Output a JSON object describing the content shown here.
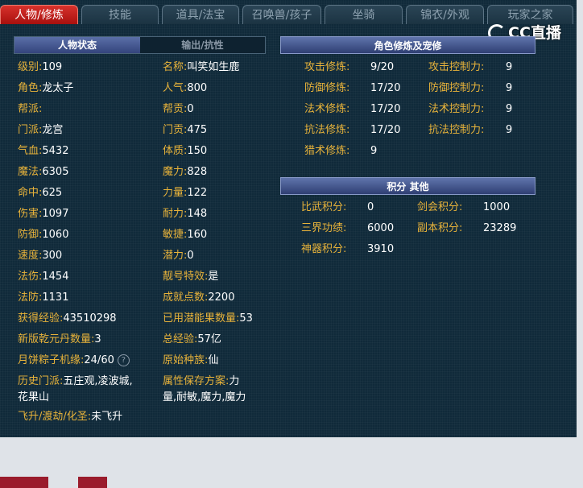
{
  "tabs": [
    "人物/修炼",
    "技能",
    "道具/法宝",
    "召唤兽/孩子",
    "坐骑",
    "锦衣/外观",
    "玩家之家"
  ],
  "logo": "CC直播",
  "subtabs": {
    "active": "人物状态",
    "inactive": "输出/抗性"
  },
  "left_stats": [
    {
      "k": "级别:",
      "v": "109"
    },
    {
      "k": "角色:",
      "v": "龙太子"
    },
    {
      "k": "帮派:",
      "v": ""
    },
    {
      "k": "门派:",
      "v": "龙宫"
    },
    {
      "k": "气血:",
      "v": "5432"
    },
    {
      "k": "魔法:",
      "v": "6305"
    },
    {
      "k": "命中:",
      "v": "625"
    },
    {
      "k": "伤害:",
      "v": "1097"
    },
    {
      "k": "防御:",
      "v": "1060"
    },
    {
      "k": "速度:",
      "v": "300"
    },
    {
      "k": "法伤:",
      "v": "1454"
    },
    {
      "k": "法防:",
      "v": "1131"
    },
    {
      "k": "获得经验:",
      "v": "43510298"
    },
    {
      "k": "新版乾元丹数量:",
      "v": "3"
    },
    {
      "k": "月饼粽子机缘:",
      "v": "24/60"
    }
  ],
  "mid_stats": [
    {
      "k": "名称:",
      "v": "叫笑如生鹿"
    },
    {
      "k": "人气:",
      "v": "800"
    },
    {
      "k": "帮贡:",
      "v": "0"
    },
    {
      "k": "门贡:",
      "v": "475"
    },
    {
      "k": "体质:",
      "v": "150"
    },
    {
      "k": "魔力:",
      "v": "828"
    },
    {
      "k": "力量:",
      "v": "122"
    },
    {
      "k": "耐力:",
      "v": "148"
    },
    {
      "k": "敏捷:",
      "v": "160"
    },
    {
      "k": "潜力:",
      "v": "0"
    },
    {
      "k": "靓号特效:",
      "v": "是"
    },
    {
      "k": "成就点数:",
      "v": "2200"
    },
    {
      "k": "已用潜能果数量:",
      "v": "53"
    },
    {
      "k": "总经验:",
      "v": "57亿"
    },
    {
      "k": "原始种族:",
      "v": "仙"
    }
  ],
  "history": {
    "k": "历史门派:",
    "v1": "五庄观,凌波城,",
    "v2": "花果山"
  },
  "attr_save": {
    "k": "属性保存方案:",
    "v1": "力",
    "v2": "量,耐敏,魔力,魔力"
  },
  "fly": {
    "k": "飞升/渡劫/化圣:",
    "v": "未飞升"
  },
  "cultivation": {
    "title": "角色修炼及宠修",
    "rows": [
      {
        "k1": "攻击修炼:",
        "v1": "9/20",
        "k2": "攻击控制力:",
        "v2": "9"
      },
      {
        "k1": "防御修炼:",
        "v1": "17/20",
        "k2": "防御控制力:",
        "v2": "9"
      },
      {
        "k1": "法术修炼:",
        "v1": "17/20",
        "k2": "法术控制力:",
        "v2": "9"
      },
      {
        "k1": "抗法修炼:",
        "v1": "17/20",
        "k2": "抗法控制力:",
        "v2": "9"
      },
      {
        "k1": "猎术修炼:",
        "v1": "9",
        "k2": "",
        "v2": ""
      }
    ]
  },
  "points": {
    "title": "积分 其他",
    "rows": [
      {
        "k1": "比武积分:",
        "v1": "0",
        "k2": "剑会积分:",
        "v2": "1000"
      },
      {
        "k1": "三界功绩:",
        "v1": "6000",
        "k2": "副本积分:",
        "v2": "23289"
      },
      {
        "k1": "神器积分:",
        "v1": "3910",
        "k2": "",
        "v2": ""
      }
    ]
  },
  "colors": {
    "label": "#e8b33a",
    "value": "#ffffff",
    "tab_active": "#c4201c",
    "bg": "#102a3a"
  }
}
